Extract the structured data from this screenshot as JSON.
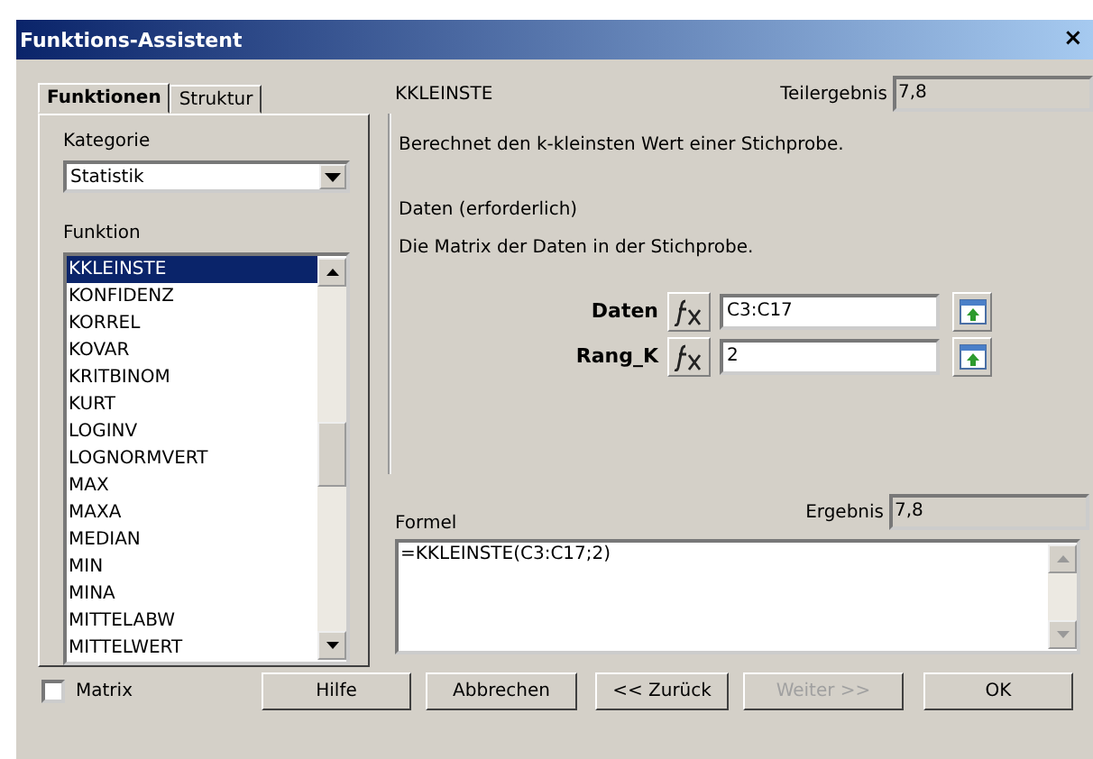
{
  "window": {
    "title": "Funktions-Assistent",
    "close": "×"
  },
  "tabs": [
    {
      "label": "Funktionen",
      "selected": true
    },
    {
      "label": "Struktur",
      "selected": false
    }
  ],
  "category": {
    "label": "Kategorie",
    "value": "Statistik"
  },
  "function_list": {
    "label": "Funktion",
    "items": [
      {
        "label": "KKLEINSTE",
        "selected": true
      },
      {
        "label": "KONFIDENZ",
        "selected": false
      },
      {
        "label": "KORREL",
        "selected": false
      },
      {
        "label": "KOVAR",
        "selected": false
      },
      {
        "label": "KRITBINOM",
        "selected": false
      },
      {
        "label": "KURT",
        "selected": false
      },
      {
        "label": "LOGINV",
        "selected": false
      },
      {
        "label": "LOGNORMVERT",
        "selected": false
      },
      {
        "label": "MAX",
        "selected": false
      },
      {
        "label": "MAXA",
        "selected": false
      },
      {
        "label": "MEDIAN",
        "selected": false
      },
      {
        "label": "MIN",
        "selected": false
      },
      {
        "label": "MINA",
        "selected": false
      },
      {
        "label": "MITTELABW",
        "selected": false
      },
      {
        "label": "MITTELWERT",
        "selected": false
      }
    ]
  },
  "function_name": "KKLEINSTE",
  "partial_result": {
    "label": "Teilergebnis",
    "value": "7,8"
  },
  "description": "Berechnet den k-kleinsten Wert einer Stichprobe.",
  "argument_title": "Daten (erforderlich)",
  "argument_description": "Die Matrix der Daten in der Stichprobe.",
  "arguments": [
    {
      "label": "Daten",
      "value": "C3:C17"
    },
    {
      "label": "Rang_K",
      "value": "2"
    }
  ],
  "formula": {
    "label": "Formel",
    "value": "=KKLEINSTE(C3:C17;2)"
  },
  "result": {
    "label": "Ergebnis",
    "value": "7,8"
  },
  "matrix": {
    "label": "Matrix",
    "checked": false
  },
  "buttons": [
    {
      "label": "Hilfe",
      "disabled": false
    },
    {
      "label": "Abbrechen",
      "disabled": false
    },
    {
      "label": "<< Zurück",
      "disabled": false
    },
    {
      "label": "Weiter >>",
      "disabled": true
    },
    {
      "label": "OK",
      "disabled": false
    }
  ]
}
